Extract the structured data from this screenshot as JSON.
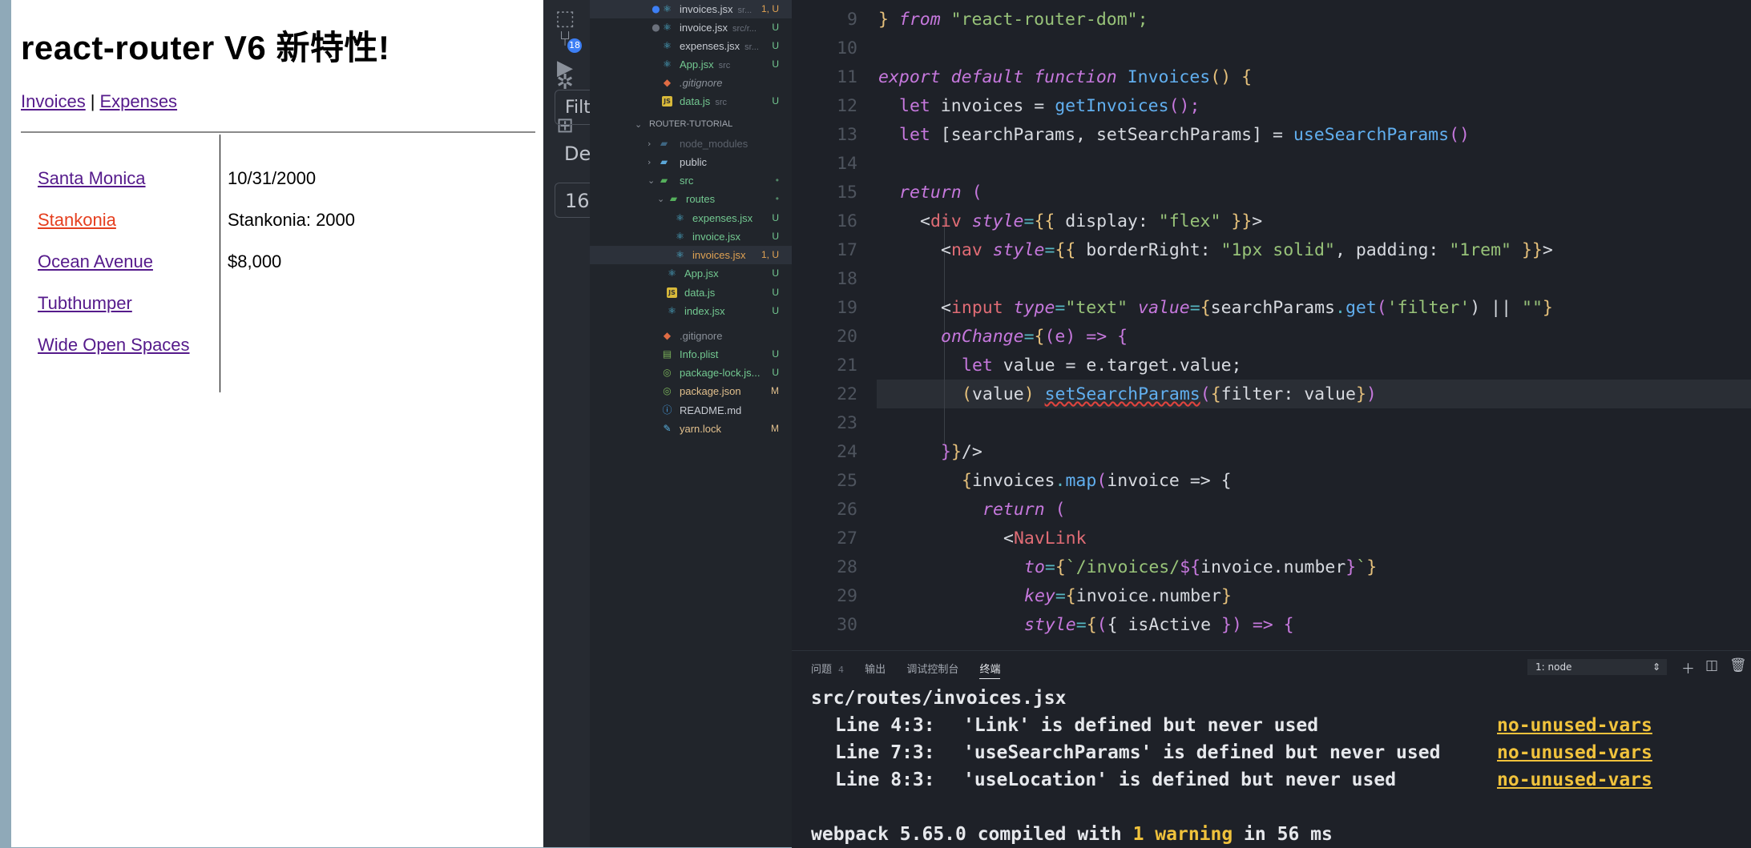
{
  "browser": {
    "title": "react-router V6 新特性!",
    "nav": {
      "invoices": "Invoices",
      "separator": "|",
      "expenses": "Expenses"
    },
    "invoice_links": [
      "Santa Monica",
      "Stankonia",
      "Ocean Avenue",
      "Tubthumper",
      "Wide Open Spaces"
    ],
    "active_link": "Stankonia",
    "details": {
      "due": "10/31/2000",
      "name_line": "Stankonia: 2000",
      "amount": "$8,000"
    },
    "colors": {
      "link": "#551a8b",
      "active": "#e53e1e"
    }
  },
  "peek": {
    "filter": "Filt",
    "de": "De",
    "num": "16"
  },
  "activity_bar": {
    "icons": [
      "inspect-icon",
      "source-control-icon",
      "run-icon",
      "debug-icon",
      "extensions-icon"
    ],
    "badge": "18"
  },
  "explorer": {
    "open_editors": [
      {
        "name": "invoices.jsx",
        "desc": "sr...",
        "status": "1, U"
      },
      {
        "name": "invoice.jsx",
        "desc": "src/r...",
        "status": "U"
      },
      {
        "name": "expenses.jsx",
        "desc": "sr...",
        "status": "U"
      },
      {
        "name": "App.jsx",
        "desc": "src",
        "status": "U"
      },
      {
        "name": ".gitignore",
        "desc": "",
        "status": ""
      },
      {
        "name": "data.js",
        "desc": "src",
        "status": "U"
      }
    ],
    "section": "ROUTER-TUTORIAL",
    "tree": [
      {
        "name": "node_modules",
        "status": ""
      },
      {
        "name": "public",
        "status": ""
      },
      {
        "name": "src",
        "status": "•"
      },
      {
        "name": "routes",
        "status": "•"
      },
      {
        "name": "expenses.jsx",
        "status": "U"
      },
      {
        "name": "invoice.jsx",
        "status": "U"
      },
      {
        "name": "invoices.jsx",
        "status": "1, U"
      },
      {
        "name": "App.jsx",
        "status": "U"
      },
      {
        "name": "data.js",
        "status": "U"
      },
      {
        "name": "index.jsx",
        "status": "U"
      },
      {
        "name": ".gitignore",
        "status": ""
      },
      {
        "name": "Info.plist",
        "status": "U"
      },
      {
        "name": "package-lock.js...",
        "status": "U"
      },
      {
        "name": "package.json",
        "status": "M"
      },
      {
        "name": "README.md",
        "status": ""
      },
      {
        "name": "yarn.lock",
        "status": "M"
      }
    ]
  },
  "editor": {
    "line_numbers": [
      "9",
      "10",
      "11",
      "12",
      "13",
      "14",
      "15",
      "16",
      "17",
      "18",
      "19",
      "20",
      "21",
      "22",
      "23",
      "24",
      "25",
      "26",
      "27",
      "28",
      "29",
      "30"
    ],
    "lines": {
      "l9": [
        "} ",
        "from",
        " \"react-router-dom\";"
      ],
      "l11": [
        "export",
        " ",
        "default",
        " ",
        "function",
        " ",
        "Invoices",
        "() {"
      ],
      "l12": [
        "let",
        " invoices = ",
        "getInvoices",
        "();"
      ],
      "l13": [
        "let",
        " [searchParams, setSearchParams] = ",
        "useSearchParams",
        "()"
      ],
      "l15": [
        "return",
        " ("
      ],
      "l16": [
        "<",
        "div",
        " ",
        "style",
        "=",
        "{{",
        " display: ",
        "\"flex\"",
        " ",
        "}}",
        ">"
      ],
      "l17": [
        "<",
        "nav",
        " ",
        "style",
        "=",
        "{{",
        " borderRight: ",
        "\"1px solid\"",
        ", padding: ",
        "\"1rem\"",
        " ",
        "}}",
        ">"
      ],
      "l19": [
        "<",
        "input",
        " ",
        "type",
        "=",
        "\"text\"",
        " ",
        "value",
        "=",
        "{",
        "searchParams",
        ".",
        "get",
        "(",
        "'filter'",
        ") || ",
        "\"\"",
        "}"
      ],
      "l20": [
        "onChange",
        "=",
        "{",
        "(e) => {"
      ],
      "l21": [
        "let",
        " value = e.target.value;"
      ],
      "l22": [
        "(",
        "value",
        ") ",
        "setSearchParams",
        "(",
        "{",
        "filter: value",
        "}",
        ")"
      ],
      "l24": [
        "}",
        "}",
        "/>"
      ],
      "l25": [
        "{",
        "invoices",
        ".",
        "map",
        "(",
        "invoice => {"
      ],
      "l26": [
        "return",
        " ("
      ],
      "l27": [
        "<",
        "NavLink"
      ],
      "l28": [
        "to",
        "=",
        "{",
        "`/invoices/",
        "${",
        "invoice.number",
        "}",
        "`",
        "}"
      ],
      "l29": [
        "key",
        "=",
        "{",
        "invoice.number",
        "}"
      ],
      "l30": [
        "style",
        "=",
        "{",
        "(",
        "{ isActive ",
        "}",
        ") => {"
      ]
    }
  },
  "panel": {
    "tabs": [
      "问题",
      "输出",
      "调试控制台",
      "终端"
    ],
    "problems_count": "4",
    "active_tab": "终端",
    "terminal_select": "1: node",
    "file": "src/routes/invoices.jsx",
    "warnings": [
      {
        "loc": "Line 4:3:",
        "msg": "'Link' is defined but never used",
        "rule": "no-unused-vars"
      },
      {
        "loc": "Line 7:3:",
        "msg": "'useSearchParams' is defined but never used",
        "rule": "no-unused-vars"
      },
      {
        "loc": "Line 8:3:",
        "msg": "'useLocation' is defined but never used",
        "rule": "no-unused-vars"
      }
    ],
    "compiled": {
      "prefix": "webpack 5.65.0 compiled with ",
      "warning": "1 warning",
      "suffix": " in 56 ms"
    }
  }
}
